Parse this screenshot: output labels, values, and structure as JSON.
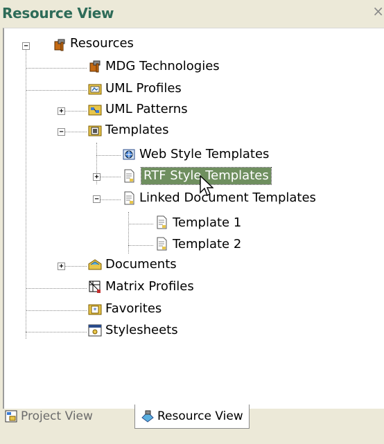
{
  "window": {
    "title": "Resource View",
    "close_glyph": "×"
  },
  "tree": {
    "root": {
      "label": "Resources",
      "icon": "resources-toolbox-icon",
      "toggle": "−"
    },
    "items": [
      {
        "label": "MDG Technologies",
        "icon": "mdg-toolbox-icon"
      },
      {
        "label": "UML Profiles",
        "icon": "uml-profile-icon"
      },
      {
        "label": "UML Patterns",
        "icon": "uml-pattern-icon",
        "toggle": "+"
      },
      {
        "label": "Templates",
        "icon": "templates-folder-icon",
        "toggle": "−"
      },
      {
        "label": "Web Style Templates",
        "icon": "web-template-icon"
      },
      {
        "label": "RTF Style Templates",
        "icon": "rtf-document-icon",
        "toggle": "+",
        "selected": true
      },
      {
        "label": "Linked Document Templates",
        "icon": "linked-document-icon",
        "toggle": "−"
      },
      {
        "label": "Template 1",
        "icon": "document-icon"
      },
      {
        "label": "Template 2",
        "icon": "document-icon"
      },
      {
        "label": "Documents",
        "icon": "documents-folder-icon",
        "toggle": "+"
      },
      {
        "label": "Matrix Profiles",
        "icon": "matrix-profile-icon"
      },
      {
        "label": "Favorites",
        "icon": "favorites-star-icon"
      },
      {
        "label": "Stylesheets",
        "icon": "stylesheet-icon"
      }
    ]
  },
  "tabs": [
    {
      "label": "Project View",
      "icon": "project-view-icon",
      "active": false
    },
    {
      "label": "Resource View",
      "icon": "resource-view-icon",
      "active": true
    }
  ],
  "colors": {
    "title": "#2d6b58",
    "selection": "#6f8f5f",
    "background": "#ece9d8"
  }
}
